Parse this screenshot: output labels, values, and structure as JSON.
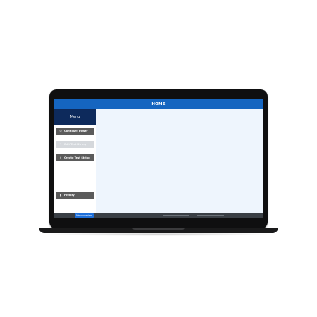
{
  "window": {
    "title": "HOME"
  },
  "sidebar": {
    "header": "Menu",
    "items": [
      {
        "label": "Configure Power",
        "icon": "power-icon",
        "enabled": true
      },
      {
        "label": "Edit Test String",
        "icon": "pencil-icon",
        "enabled": false
      },
      {
        "label": "Create Test String",
        "icon": "tools-icon",
        "enabled": true
      },
      {
        "label": "History",
        "icon": "document-icon",
        "enabled": true
      }
    ]
  },
  "status": {
    "connection": "Disconnected"
  },
  "colors": {
    "titlebar": "#1565c0",
    "menu_header": "#0d2a5c",
    "button": "#5b5b5b",
    "button_disabled": "#d5d8dc",
    "content_bg": "#eef5fd",
    "status_badge": "#1e6fd9"
  }
}
